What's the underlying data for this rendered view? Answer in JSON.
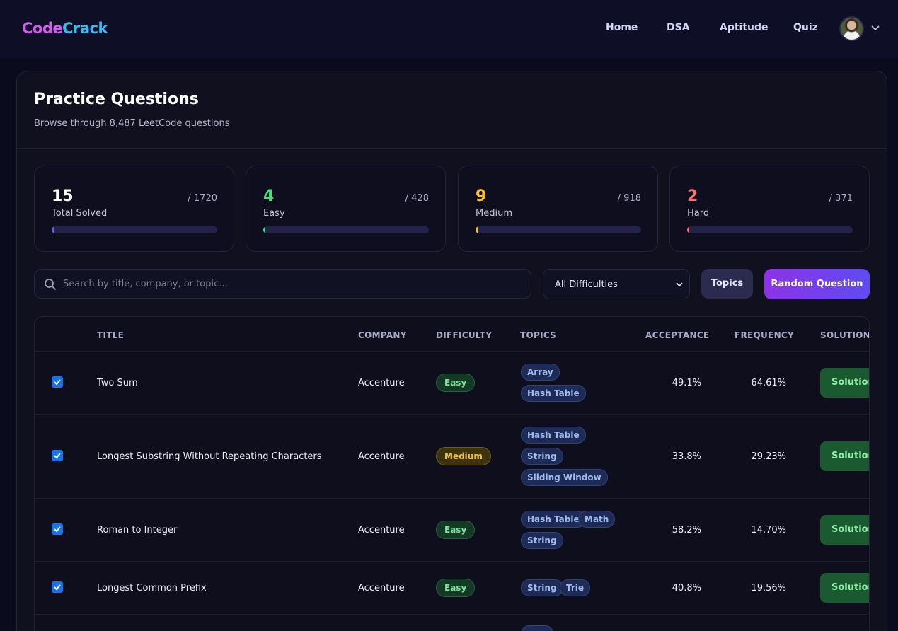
{
  "header": {
    "logo_part1": "Code",
    "logo_part2": "Crack",
    "nav": [
      "Home",
      "DSA",
      "Aptitude",
      "Quiz"
    ]
  },
  "page": {
    "title": "Practice Questions",
    "subtitle": "Browse through 8,487 LeetCode questions"
  },
  "stats": [
    {
      "value": "15",
      "total": "/ 1720",
      "label": "Total Solved",
      "color": "#ffffff",
      "bar_color": "#6b5cf0",
      "fraction": 0.0087
    },
    {
      "value": "4",
      "total": "/ 428",
      "label": "Easy",
      "color": "#4ade80",
      "bar_color": "#4ade80",
      "fraction": 0.0093
    },
    {
      "value": "9",
      "total": "/ 918",
      "label": "Medium",
      "color": "#fbbf24",
      "bar_color": "#fbbf24",
      "fraction": 0.0098
    },
    {
      "value": "2",
      "total": "/ 371",
      "label": "Hard",
      "color": "#f87171",
      "bar_color": "#f87171",
      "fraction": 0.0054
    }
  ],
  "controls": {
    "search_placeholder": "Search by title, company, or topic...",
    "difficulty_selected": "All Difficulties",
    "topics_label": "Topics",
    "random_label": "Random Question"
  },
  "table": {
    "headers": [
      "TITLE",
      "COMPANY",
      "DIFFICULTY",
      "TOPICS",
      "ACCEPTANCE",
      "FREQUENCY",
      "SOLUTION"
    ],
    "rows": [
      {
        "checked": true,
        "title": "Two Sum",
        "company": "Accenture",
        "difficulty": "Easy",
        "topics": [
          "Array",
          "Hash Table"
        ],
        "acceptance": "49.1%",
        "frequency": "64.61%",
        "solution": "Solution"
      },
      {
        "checked": true,
        "title": "Longest Substring Without Repeating Characters",
        "company": "Accenture",
        "difficulty": "Medium",
        "topics": [
          "Hash Table",
          "String",
          "Sliding Window"
        ],
        "acceptance": "33.8%",
        "frequency": "29.23%",
        "solution": "Solution"
      },
      {
        "checked": true,
        "title": "Roman to Integer",
        "company": "Accenture",
        "difficulty": "Easy",
        "topics": [
          "Hash Table",
          "Math",
          "String"
        ],
        "acceptance": "58.2%",
        "frequency": "14.70%",
        "solution": "Solution"
      },
      {
        "checked": true,
        "title": "Longest Common Prefix",
        "company": "Accenture",
        "difficulty": "Easy",
        "topics": [
          "String",
          "Trie"
        ],
        "acceptance": "40.8%",
        "frequency": "19.56%",
        "solution": "Solution"
      }
    ]
  }
}
